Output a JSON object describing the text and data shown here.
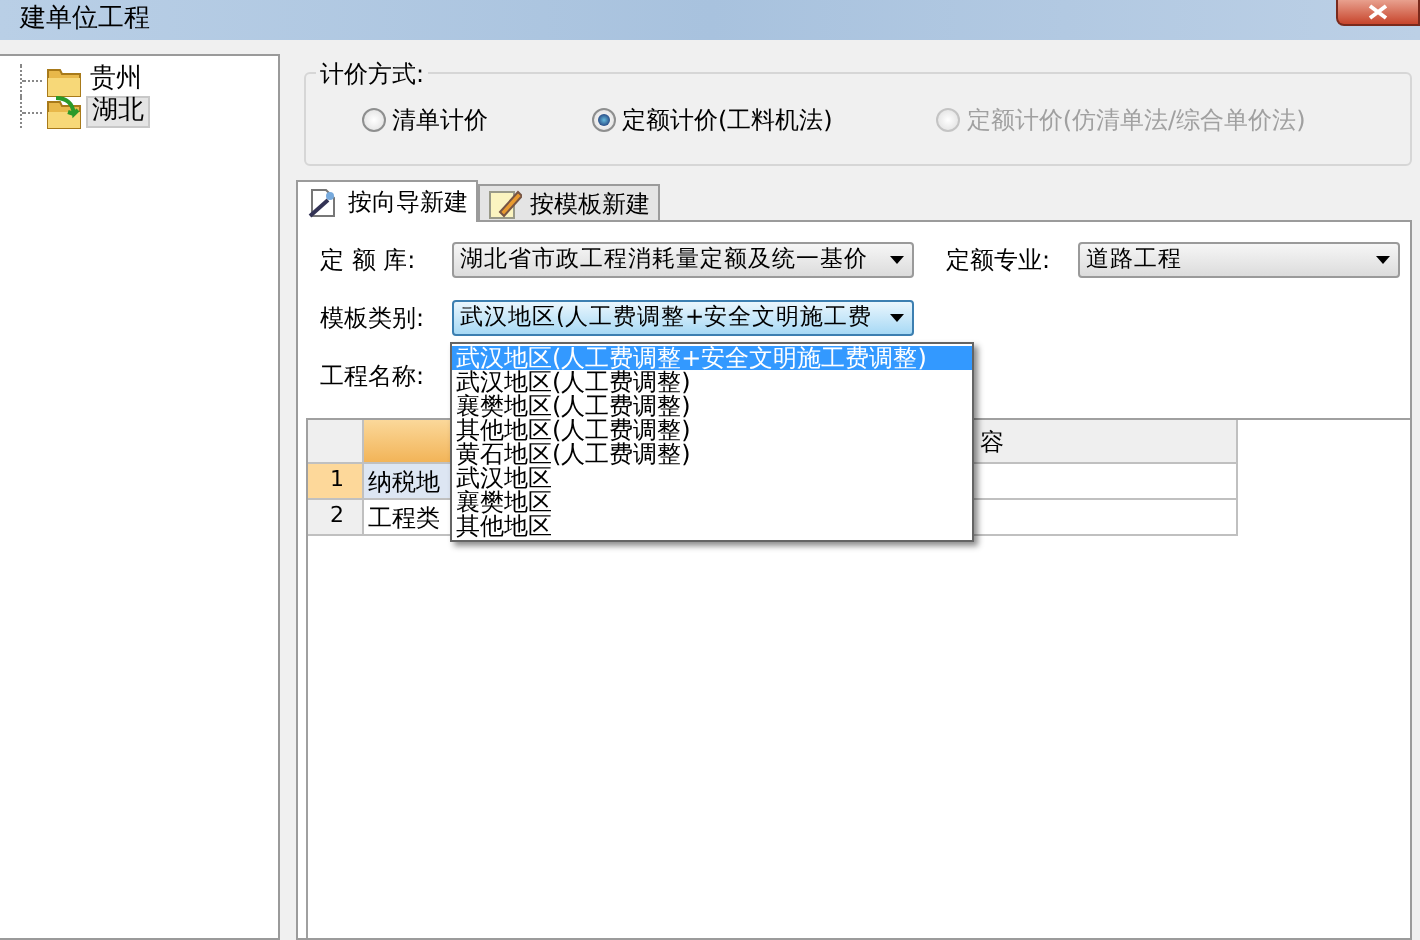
{
  "window": {
    "title": "建单位工程"
  },
  "tree": [
    {
      "label": "贵州",
      "selected": false,
      "kind": "folder"
    },
    {
      "label": "湖北",
      "selected": true,
      "kind": "folder-arrow"
    }
  ],
  "pricing_method": {
    "label": "计价方式:",
    "options": [
      {
        "label": "清单计价",
        "selected": false,
        "disabled": false
      },
      {
        "label": "定额计价(工料机法)",
        "selected": true,
        "disabled": false
      },
      {
        "label": "定额计价(仿清单法/综合单价法)",
        "selected": false,
        "disabled": true
      }
    ]
  },
  "tabs": [
    {
      "label": "按向导新建",
      "selected": true,
      "kind": "wizard"
    },
    {
      "label": "按模板新建",
      "selected": false,
      "kind": "note"
    }
  ],
  "form": {
    "quota_library": {
      "label": "定 额 库:",
      "value": "湖北省市政工程消耗量定额及统一基价"
    },
    "specialty": {
      "label": "定额专业:",
      "value": "道路工程"
    },
    "template_category": {
      "label": "模板类别:",
      "value": "武汉地区(人工费调整+安全文明施工费",
      "expanded": true,
      "options": [
        {
          "label": "武汉地区(人工费调整+安全文明施工费调整)",
          "selected": true
        },
        {
          "label": "武汉地区(人工费调整)",
          "selected": false
        },
        {
          "label": "襄樊地区(人工费调整)",
          "selected": false
        },
        {
          "label": "其他地区(人工费调整)",
          "selected": false
        },
        {
          "label": "黄石地区(人工费调整)",
          "selected": false
        },
        {
          "label": "武汉地区",
          "selected": false
        },
        {
          "label": "襄樊地区",
          "selected": false
        },
        {
          "label": "其他地区",
          "selected": false
        }
      ]
    },
    "project_name": {
      "label": "工程名称:"
    }
  },
  "table": {
    "columns": [
      "",
      "",
      "容"
    ],
    "rows": [
      {
        "number": "1",
        "cells": [
          "纳税地",
          ""
        ],
        "selected": true
      },
      {
        "number": "2",
        "cells": [
          "工程类",
          ""
        ],
        "selected": false
      }
    ]
  }
}
